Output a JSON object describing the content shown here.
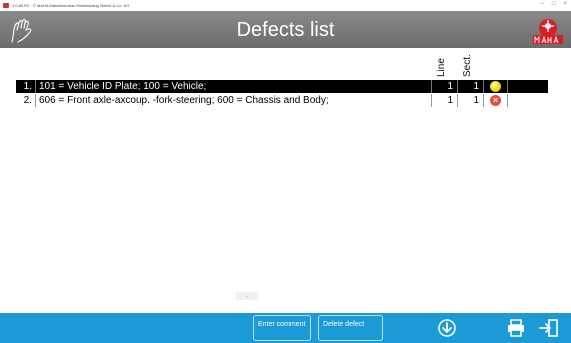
{
  "window": {
    "title": "1.0.89.R2 · © MAHA Maschinenbau Haldenwang GmbH & Co. KG",
    "controls": [
      "–",
      "□",
      "×"
    ]
  },
  "header": {
    "title": "Defects list",
    "colors": {
      "header_bg": "#777777",
      "toolbar_bg": "#1c9ad6",
      "logo_red": "#d81f26"
    }
  },
  "table": {
    "columns": {
      "line": "Line",
      "sect": "Sect."
    },
    "rows": [
      {
        "num": "1.",
        "description": "101 = Vehicle ID Plate; 100 = Vehicle;",
        "line": "1",
        "sect": "1",
        "status": "yellow-dot",
        "selected": true
      },
      {
        "num": "2.",
        "description": "606 = Front axle-axcoup. -fork-steering; 600 = Chassis and Body;",
        "line": "1",
        "sect": "1",
        "status": "red-x-dot",
        "selected": false
      }
    ]
  },
  "scroll_hint": ".",
  "toolbar": {
    "enter_comment": "Enter comment",
    "delete_defect": "Delete defect",
    "icons": [
      "download-arrow-icon",
      "printer-icon",
      "exit-door-icon"
    ]
  }
}
